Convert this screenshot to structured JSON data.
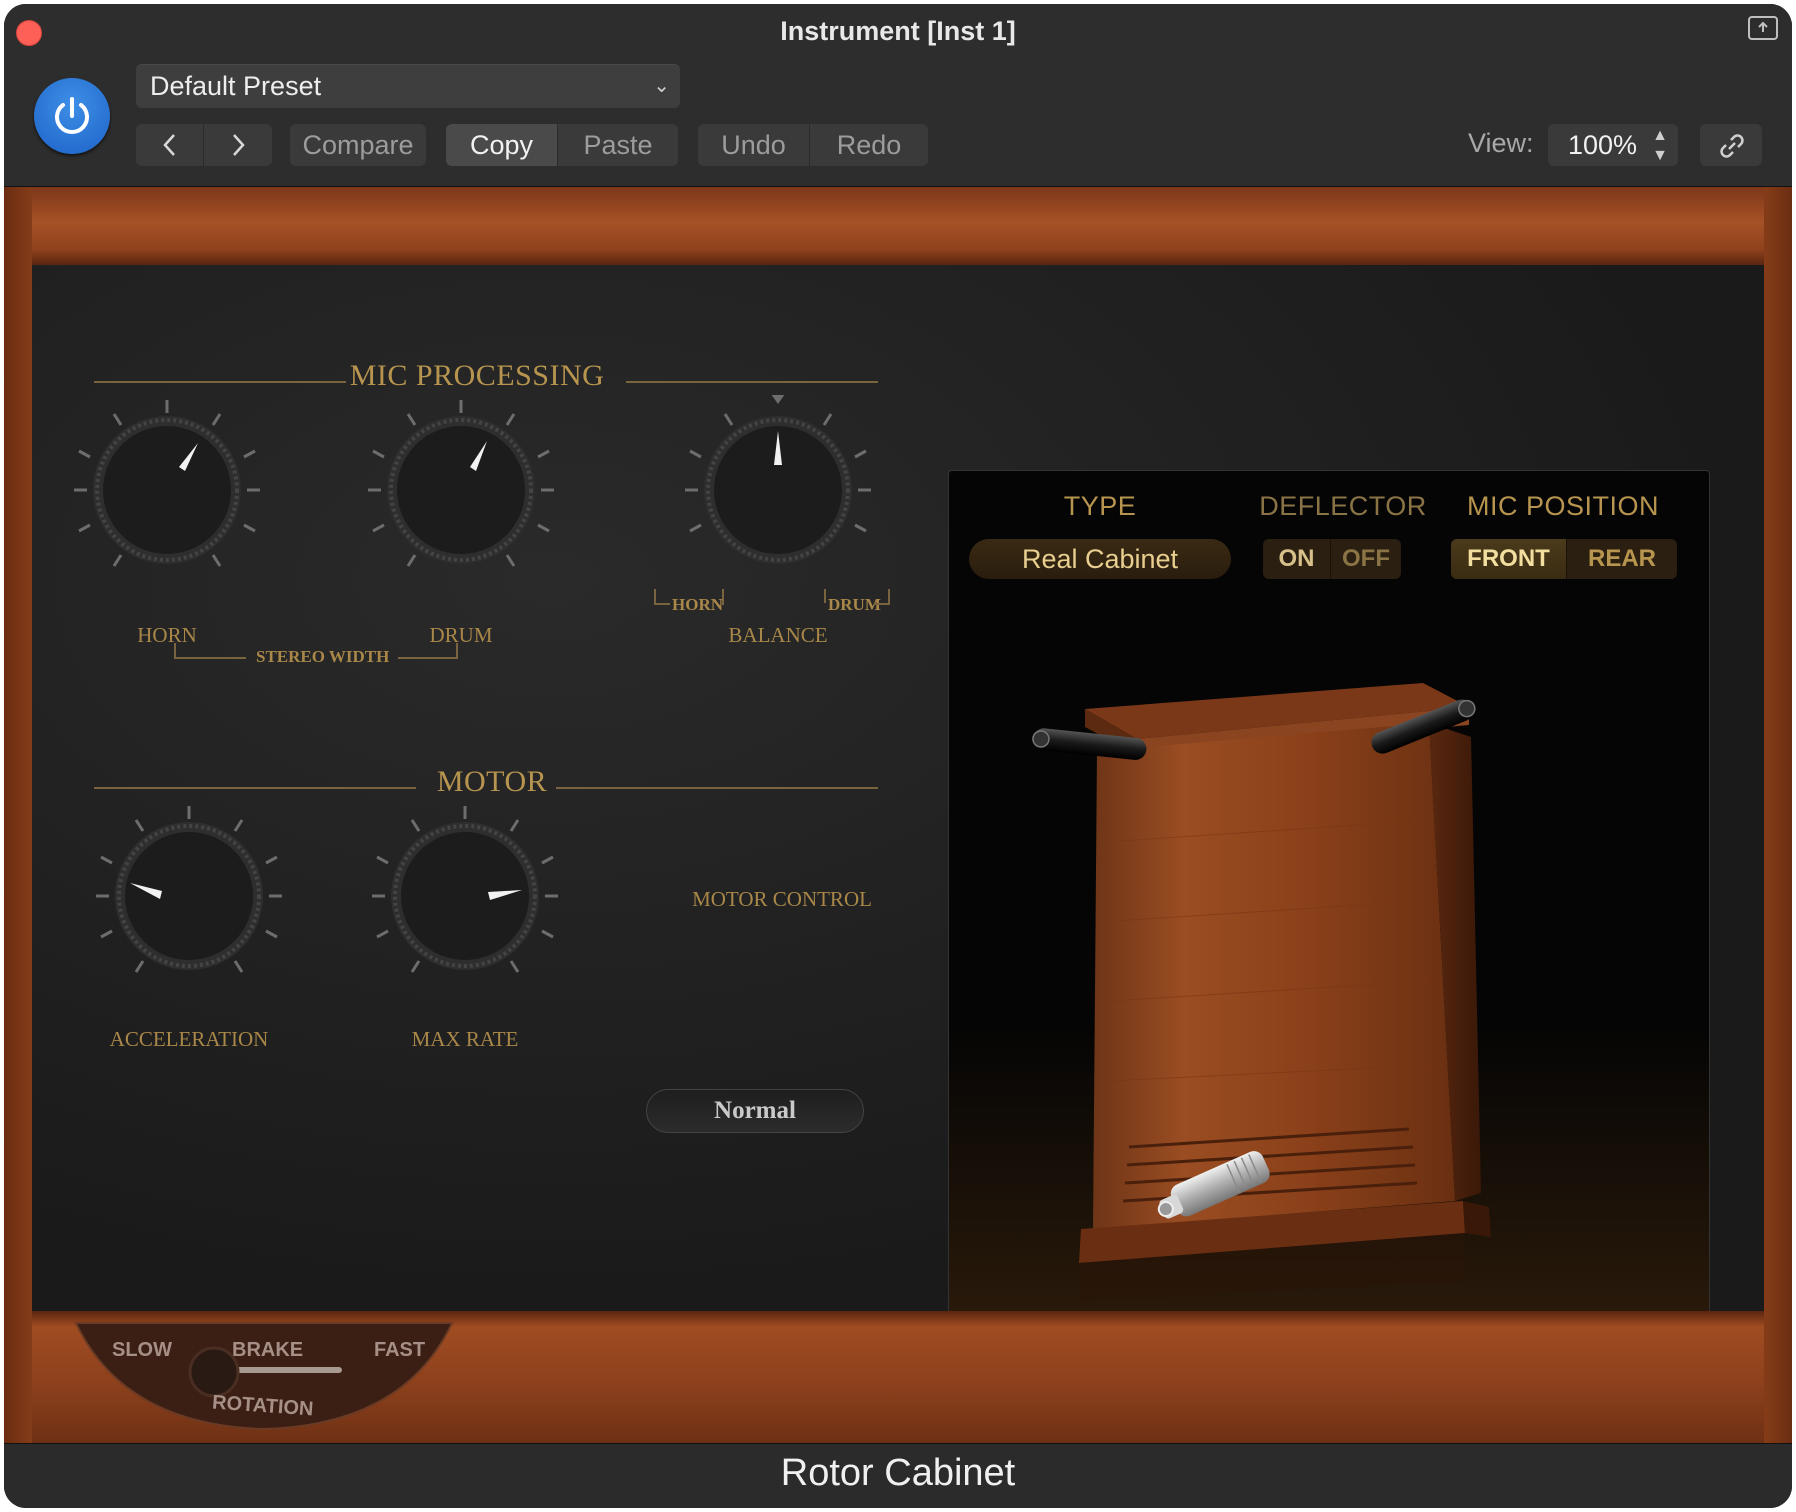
{
  "window": {
    "title": "Instrument [Inst 1]"
  },
  "header": {
    "preset": "Default Preset",
    "compare": "Compare",
    "copy": "Copy",
    "paste": "Paste",
    "undo": "Undo",
    "redo": "Redo",
    "view_label": "View:",
    "view_value": "100%"
  },
  "mic_processing": {
    "title": "MIC PROCESSING",
    "horn": "HORN",
    "drum": "DRUM",
    "stereo_width": "STEREO WIDTH",
    "balance": "BALANCE",
    "balance_left": "HORN",
    "balance_right": "DRUM"
  },
  "motor": {
    "title": "MOTOR",
    "acceleration": "ACCELERATION",
    "max_rate": "MAX RATE",
    "motor_control_label": "MOTOR CONTROL",
    "motor_control_value": "Normal"
  },
  "display": {
    "type_label": "TYPE",
    "type_value": "Real Cabinet",
    "deflector_label": "DEFLECTOR",
    "deflector_on": "ON",
    "deflector_off": "OFF",
    "mic_position_label": "MIC POSITION",
    "mic_front": "FRONT",
    "mic_rear": "REAR"
  },
  "rotation": {
    "slow": "SLOW",
    "brake": "BRAKE",
    "fast": "FAST",
    "label": "ROTATION"
  },
  "footer": {
    "plugin_name": "Rotor Cabinet"
  },
  "colors": {
    "accent_gold": "#b8954f",
    "power_blue": "#2a78d8",
    "wood": "#8c4019"
  }
}
